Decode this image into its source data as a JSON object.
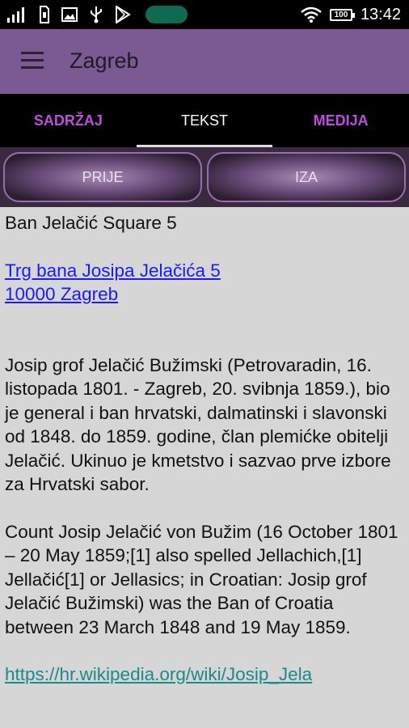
{
  "status_bar": {
    "time": "13:42",
    "battery": "100",
    "icons": [
      "signal-icon",
      "sim-icon",
      "image-icon",
      "usb-icon",
      "play-store-icon",
      "wifi-icon",
      "battery-icon"
    ]
  },
  "app_bar": {
    "title": "Zagreb"
  },
  "tabs": [
    {
      "label": "SADRŽAJ"
    },
    {
      "label": "TEKST"
    },
    {
      "label": "MEDIJA"
    }
  ],
  "buttons": {
    "prev_label": "PRIJE",
    "next_label": "IZA"
  },
  "article": {
    "heading": "Ban Jelačić Square 5",
    "address_line1": "Trg bana Josipa Jelačića 5",
    "address_line2": "10000 Zagreb",
    "paragraph_hr": "Josip grof Jelačić Bužimski (Petrovaradin, 16. listopada 1801. - Zagreb, 20. svibnja 1859.), bio je general i ban hrvatski, dalmatinski i slavonski od 1848. do 1859. godine, član plemićke obitelji Jelačić. Ukinuo je kmetstvo i sazvao prve izbore za Hrvatski sabor.",
    "paragraph_en": "Count Josip Jelačić von Bužim (16 October 1801 – 20 May 1859;[1] also spelled Jellachich,[1] Jellačić[1] or Jellasics; in Croatian: Josip grof Jelačić Bužimski) was the Ban of Croatia between 23 March 1848 and 19 May 1859.",
    "link": "https://hr.wikipedia.org/wiki/Josip_Jela"
  },
  "colors": {
    "app_bar": "#7b5a93",
    "tab_accent": "#c04de0",
    "content_bg": "#d6d6d6"
  }
}
